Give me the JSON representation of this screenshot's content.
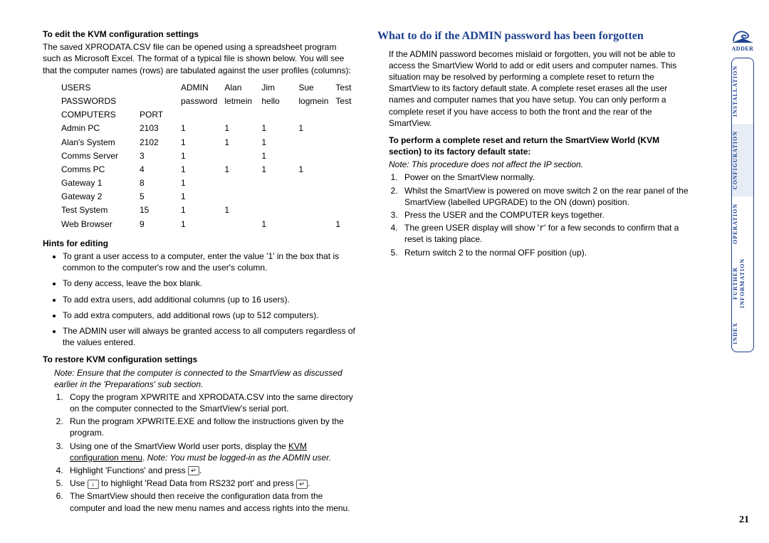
{
  "page_number": "21",
  "brand": "ADDER",
  "left": {
    "h_edit": "To edit the KVM configuration settings",
    "edit_para": "The saved XPRODATA.CSV file can be opened using a spreadsheet program such as Microsoft Excel. The format of a typical file is shown below. You will see that the computer names (rows) are tabulated against the user profiles (columns):",
    "table": {
      "r1": [
        "USERS",
        "",
        "ADMIN",
        "Alan",
        "Jim",
        "Sue",
        "Test"
      ],
      "r2": [
        "PASSWORDS",
        "",
        "password",
        "letmein",
        "hello",
        "logmein",
        "Test"
      ],
      "r3": [
        "COMPUTERS",
        "PORT",
        "",
        "",
        "",
        "",
        ""
      ],
      "r4": [
        "Admin PC",
        "2103",
        "1",
        "1",
        "1",
        "1",
        ""
      ],
      "r5": [
        "Alan's System",
        "2102",
        "1",
        "1",
        "1",
        "",
        ""
      ],
      "r6": [
        "Comms Server",
        "3",
        "1",
        "",
        "1",
        "",
        ""
      ],
      "r7": [
        "Comms PC",
        "4",
        "1",
        "1",
        "1",
        "1",
        ""
      ],
      "r8": [
        "Gateway 1",
        "8",
        "1",
        "",
        "",
        "",
        ""
      ],
      "r9": [
        "Gateway 2",
        "5",
        "1",
        "",
        "",
        "",
        ""
      ],
      "r10": [
        "Test System",
        "15",
        "1",
        "1",
        "",
        "",
        ""
      ],
      "r11": [
        "Web Browser",
        "9",
        "1",
        "",
        "1",
        "",
        "1"
      ]
    },
    "h_hints": "Hints for editing",
    "hints": [
      "To grant a user access to a computer, enter the value '1' in the box that is common to the computer's row and the user's column.",
      "To deny access, leave the box blank.",
      "To add extra users, add additional columns (up to 16 users).",
      "To add extra computers, add additional rows (up to 512 computers).",
      "The ADMIN user will always be granted access to all computers regardless of the values entered."
    ],
    "h_restore": "To restore KVM configuration settings",
    "restore_note": "Note: Ensure that the computer is connected to the SmartView as discussed earlier in the 'Preparations' sub section.",
    "restore_steps": {
      "s1": "Copy the program XPWRITE and XPRODATA.CSV into the same directory on the computer connected to the SmartView's serial port.",
      "s2": "Run the program XPWRITE.EXE and follow the instructions given by the program.",
      "s3a": "Using one of the SmartView World user ports, display the ",
      "s3_link": "KVM configuration menu",
      "s3b": ". ",
      "s3_note": "Note: You must be logged-in as the ADMIN user.",
      "s4a": "Highlight 'Functions' and press ",
      "s4b": ".",
      "s5a": "Use ",
      "s5b": " to highlight 'Read Data from RS232 port' and press ",
      "s5c": ".",
      "s6": "The SmartView should then receive the configuration data from the computer and load the new menu names and access rights into the menu."
    }
  },
  "right": {
    "title": "What to do if the ADMIN password has been forgotten",
    "para": "If the ADMIN password becomes mislaid or forgotten, you will not be able to access the SmartView World to add or edit users and computer names. This situation may be resolved by performing a complete reset to return the SmartView to its factory default state. A complete reset erases all the user names and computer names that you have setup. You can only perform a complete reset if you have access to both the front and the rear of the SmartView.",
    "h_reset": "To perform a complete reset and return the SmartView World (KVM section) to its factory default state:",
    "reset_note": "Note: This procedure does not affect the IP section.",
    "steps": {
      "s1": "Power on the SmartView normally.",
      "s2": "Whilst the SmartView is powered on move switch 2 on the rear panel of the SmartView (labelled UPGRADE) to the ON (down) position.",
      "s3": "Press the USER and the COMPUTER keys together.",
      "s4a": "The green USER display will show '",
      "s4_glyph": "r",
      "s4b": "' for a few seconds to confirm that a reset is taking place.",
      "s5": "Return switch 2 to the normal OFF position (up)."
    }
  },
  "nav": {
    "installation": "INSTALLATION",
    "configuration": "CONFIGURATION",
    "operation": "OPERATION",
    "further_info_l1": "FURTHER",
    "further_info_l2": "INFORMATION",
    "index": "INDEX"
  },
  "icons": {
    "enter": "↵",
    "down": "↓"
  }
}
